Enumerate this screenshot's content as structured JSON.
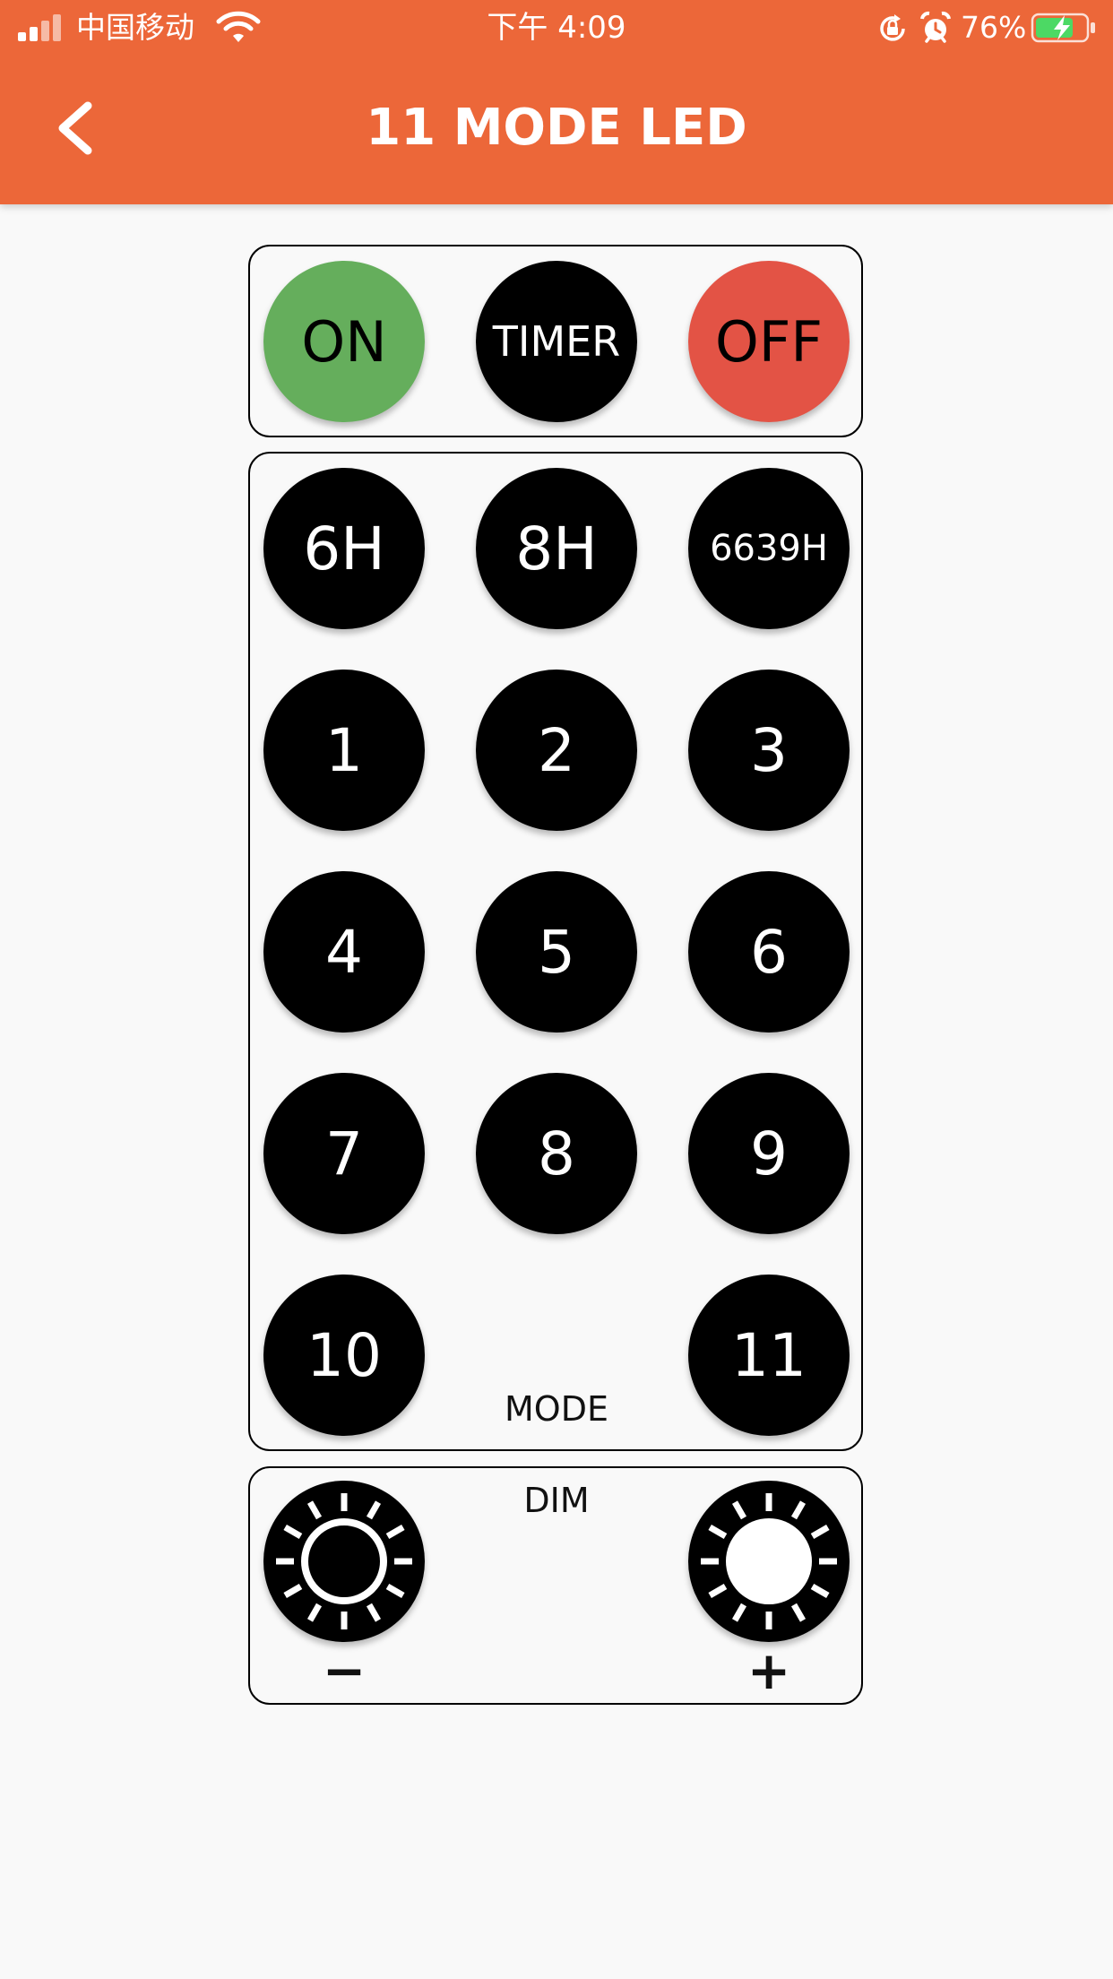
{
  "status_bar": {
    "carrier": "中国移动",
    "time": "下午 4:09",
    "battery": "76%",
    "battery_level": 0.76,
    "icons": [
      "signal-icon",
      "wifi-icon",
      "orientation-lock-icon",
      "alarm-icon",
      "battery-charging-icon"
    ]
  },
  "header": {
    "title": "11 MODE LED",
    "back_icon": "chevron-left-icon"
  },
  "colors": {
    "header": "#ec6739",
    "on": "#65ae5c",
    "off": "#e35345",
    "button": "#000000",
    "background": "#f9f9f9"
  },
  "power": {
    "on_label": "ON",
    "timer_label": "TIMER",
    "off_label": "OFF"
  },
  "timer_buttons": [
    "6H",
    "8H",
    "6639H"
  ],
  "mode_buttons": [
    "1",
    "2",
    "3",
    "4",
    "5",
    "6",
    "7",
    "8",
    "9",
    "10",
    "11"
  ],
  "mode_label": "MODE",
  "dim": {
    "label": "DIM",
    "minus_label": "−",
    "plus_label": "+",
    "icons": [
      "brightness-down-icon",
      "brightness-up-icon"
    ]
  }
}
